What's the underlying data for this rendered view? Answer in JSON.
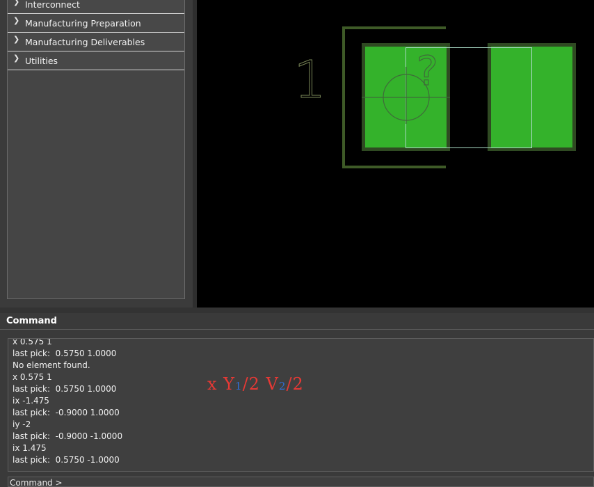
{
  "sidebar": {
    "items": [
      {
        "label": "Interconnect"
      },
      {
        "label": "Manufacturing Preparation"
      },
      {
        "label": "Manufacturing Deliverables"
      },
      {
        "label": "Utilities"
      }
    ],
    "chevron": "chevron-right-icon"
  },
  "canvas": {
    "pin_label": "1",
    "unknown_marker": "?",
    "colors": {
      "pad": "#34b22b",
      "pad_border": "#2f4a22",
      "silkscreen": "#3e5a27",
      "outline": "#a8d8c4",
      "crosshair": "#3f6b3a",
      "label": "#7d8a5a"
    }
  },
  "command": {
    "title": "Command",
    "lines": [
      "x 0.575 1",
      "last pick:  0.5750 1.0000",
      "No element found.",
      "x 0.575 1",
      "last pick:  0.5750 1.0000",
      "ix -1.475",
      "last pick:  -0.9000 1.0000",
      "iy -2",
      "last pick:  -0.9000 -1.0000",
      "ix 1.475",
      "last pick:  0.5750 -1.0000"
    ],
    "prompt": "Command >"
  },
  "annotation": {
    "part1": "x Y",
    "sub1": "1",
    "part2": "/2 V",
    "sub2": "2",
    "part3": "/2",
    "colors": {
      "main": "#e53935",
      "subscript": "#2f6fd6"
    }
  }
}
